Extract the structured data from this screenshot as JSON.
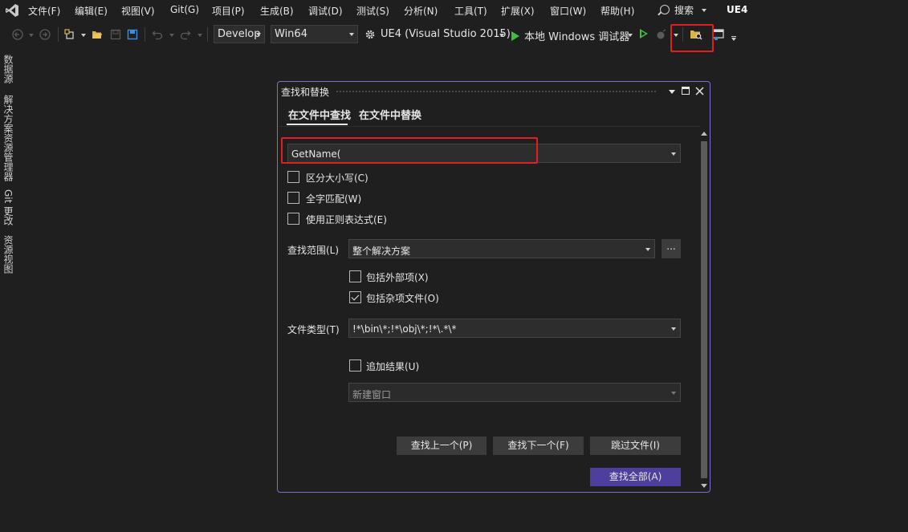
{
  "menu": {
    "items": [
      "文件(F)",
      "编辑(E)",
      "视图(V)",
      "Git(G)",
      "项目(P)",
      "生成(B)",
      "调试(D)",
      "测试(S)",
      "分析(N)",
      "工具(T)",
      "扩展(X)",
      "窗口(W)",
      "帮助(H)"
    ],
    "search_label": "搜索",
    "solution_name": "UE4"
  },
  "toolbar": {
    "config_value": "Develop",
    "platform_value": "Win64",
    "startup_project": "UE4 (Visual Studio 2015)",
    "debugger_label": "本地 Windows 调试器"
  },
  "sidebar": {
    "tabs": [
      "数据源",
      "解决方案资源管理器",
      "Git 更改",
      "资源视图"
    ]
  },
  "dialog": {
    "title": "查找和替换",
    "tabs": [
      "在文件中查找",
      "在文件中替换"
    ],
    "find_value": "GetName(",
    "options": {
      "match_case": "区分大小写(C)",
      "whole_word": "全字匹配(W)",
      "regex": "使用正则表达式(E)"
    },
    "scope_label": "查找范围(L)",
    "scope_value": "整个解决方案",
    "browse_label": "...",
    "include_external": "包括外部项(X)",
    "include_misc": "包括杂项文件(O)",
    "filetype_label": "文件类型(T)",
    "filetype_value": "!*\\bin\\*;!*\\obj\\*;!*\\.*\\*",
    "append_results": "追加结果(U)",
    "result_window": "新建窗口",
    "buttons": {
      "find_prev": "查找上一个(P)",
      "find_next": "查找下一个(F)",
      "skip_file": "跳过文件(I)",
      "find_all": "查找全部(A)"
    }
  },
  "colors": {
    "accent": "#4e3f9e",
    "dialog_border": "#7b6fd0",
    "highlight": "#e02020"
  }
}
